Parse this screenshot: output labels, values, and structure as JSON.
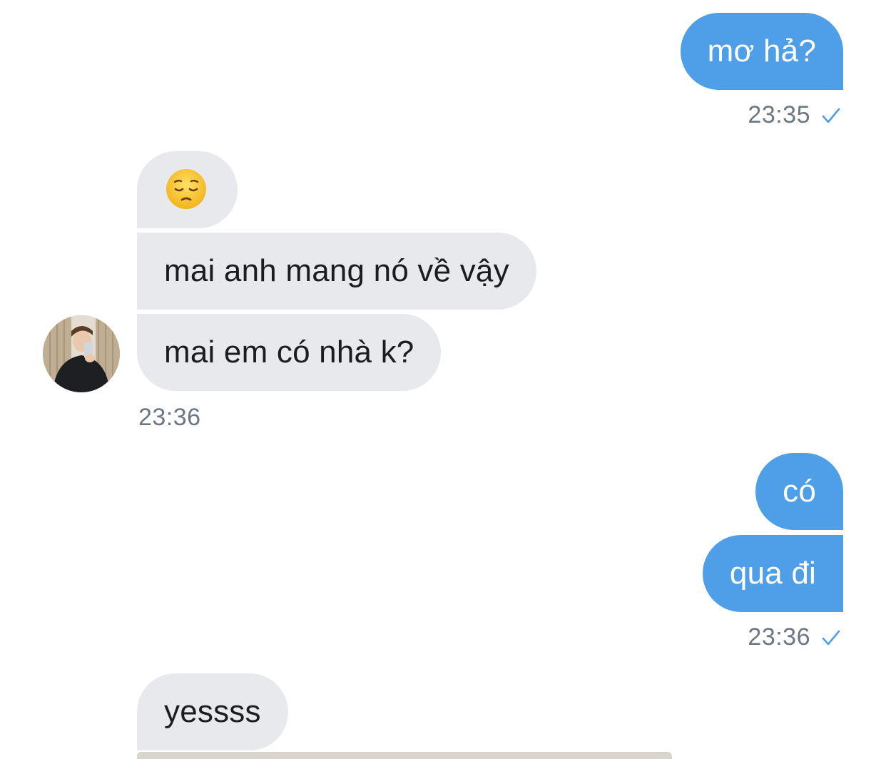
{
  "messages": {
    "m1": {
      "text": "mơ hả?",
      "time": "23:35"
    },
    "m2": {
      "emoji": "pensive-face"
    },
    "m3": {
      "text": "mai anh mang nó về vậy"
    },
    "m4": {
      "text": "mai em có nhà k?",
      "time": "23:36"
    },
    "m5": {
      "text": "có"
    },
    "m6": {
      "text": "qua đi",
      "time": "23:36"
    },
    "m7": {
      "text": "yessss"
    }
  },
  "colors": {
    "outgoing_bubble": "#4f9fe8",
    "incoming_bubble": "#e8e9ed",
    "timestamp": "#6d7784",
    "read_check": "#4f9fe8"
  }
}
